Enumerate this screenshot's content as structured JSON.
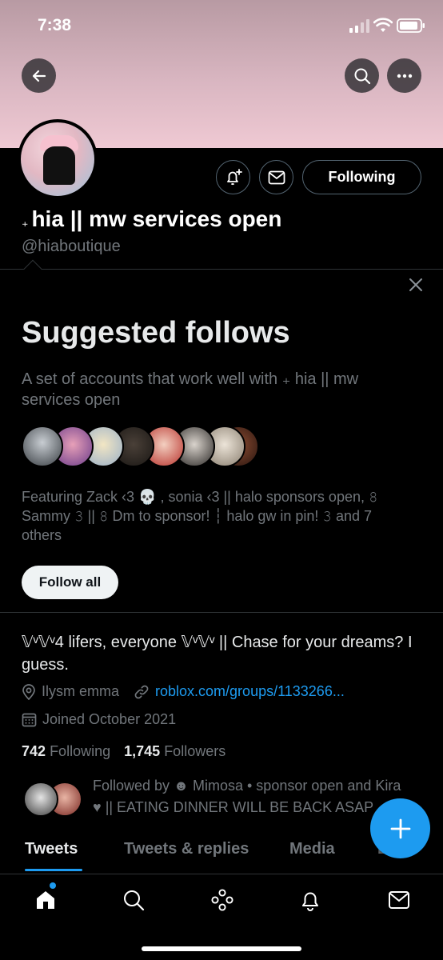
{
  "status_bar": {
    "time": "7:38"
  },
  "profile": {
    "display_name": "hia || mw services open",
    "name_prefix": "₊",
    "handle": "@hiaboutique",
    "following_button": "Following"
  },
  "suggested": {
    "title": "Suggested follows",
    "description": "A set of accounts that work well with ₊ hia || mw services open",
    "featuring_line1": "Featuring Zack ‹3 💀 , sonia ‹3 || halo sponsors open, 𝟾",
    "featuring_line2": "Sammy 𝟹 || 𝟾 Dm to sponsor! ┆ halo gw in pin! 𝟹 and 7",
    "featuring_line3": "others",
    "follow_all_label": "Follow all"
  },
  "bio": {
    "text": "𝕍ᵛ𝕍ᵛ4 lifers, everyone 𝕍ᵛ𝕍ᵛ || Chase for your dreams? I guess.",
    "location": "Ilysm emma",
    "link": "roblox.com/groups/1133266...",
    "joined": "Joined October 2021"
  },
  "counts": {
    "following_value": "742",
    "following_label": "Following",
    "followers_value": "1,745",
    "followers_label": "Followers"
  },
  "followed_by": {
    "line1": "Followed by ☻ Mimosa • sponsor open and Kira",
    "line2": "♥ || EATING DINNER WILL BE BACK ASAP"
  },
  "tabs": [
    "Tweets",
    "Tweets & replies",
    "Media",
    "Likes"
  ],
  "colors": {
    "accent": "#1d9bf0",
    "banner": "#e8c4ce",
    "background": "#000000"
  },
  "icons": {
    "back": "back-arrow-icon",
    "search": "search-icon",
    "more": "more-icon",
    "notify": "bell-plus-icon",
    "message": "envelope-icon",
    "close": "close-icon",
    "location": "location-pin-icon",
    "link": "link-icon",
    "calendar": "calendar-icon",
    "compose": "plus-icon",
    "home": "home-icon",
    "explore": "search-icon",
    "spaces": "communities-icon",
    "notifications": "bell-icon",
    "messages": "envelope-icon"
  }
}
